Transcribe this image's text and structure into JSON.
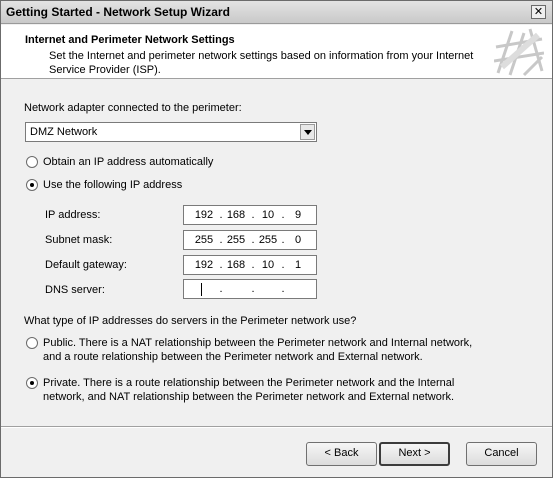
{
  "window": {
    "title": "Getting Started - Network Setup Wizard",
    "close_glyph": "✕"
  },
  "header": {
    "title": "Internet and Perimeter Network Settings",
    "description": "Set the Internet and perimeter network settings based on information from your Internet Service Provider (ISP)."
  },
  "adapter": {
    "label": "Network adapter connected to the perimeter:",
    "selected": "DMZ Network"
  },
  "ip_mode": {
    "auto_label": "Obtain an IP address automatically",
    "manual_label": "Use the following IP address",
    "selected": "manual"
  },
  "fields": {
    "ip_label": "IP address:",
    "ip": [
      "192",
      "168",
      "10",
      "9"
    ],
    "subnet_label": "Subnet mask:",
    "subnet": [
      "255",
      "255",
      "255",
      "0"
    ],
    "gateway_label": "Default gateway:",
    "gateway": [
      "192",
      "168",
      "10",
      "1"
    ],
    "dns_label": "DNS server:",
    "dns": [
      "",
      "",
      "",
      ""
    ]
  },
  "ip_type": {
    "question": "What type of IP addresses do servers in the Perimeter network use?",
    "public_text": "Public. There is a NAT relationship between the Perimeter network and Internal network, and a route relationship between the Perimeter network and External network.",
    "private_text": "Private. There is a route relationship between the Perimeter network and the Internal network, and NAT relationship between the Perimeter network and External network.",
    "selected": "private"
  },
  "buttons": {
    "back": "< Back",
    "next": "Next >",
    "cancel": "Cancel"
  }
}
